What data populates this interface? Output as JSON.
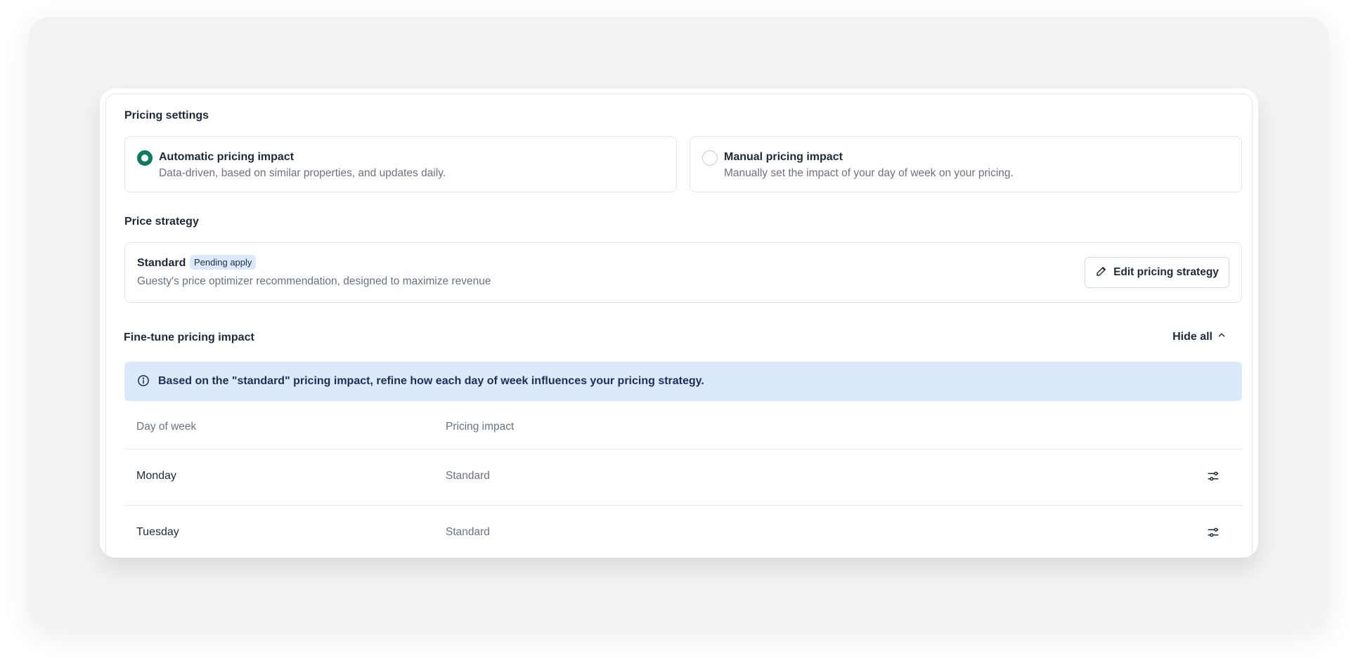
{
  "pricing_settings": {
    "title": "Pricing settings",
    "options": [
      {
        "title": "Automatic pricing impact",
        "description": "Data-driven, based on similar properties, and updates daily.",
        "selected": true
      },
      {
        "title": "Manual pricing impact",
        "description": "Manually set the impact of your day of week on your pricing.",
        "selected": false
      }
    ]
  },
  "price_strategy": {
    "title": "Price strategy",
    "name": "Standard",
    "badge": "Pending apply",
    "description": "Guesty's price optimizer recommendation, designed to maximize revenue",
    "edit_label": "Edit pricing strategy"
  },
  "fine_tune": {
    "title": "Fine-tune pricing impact",
    "hide_label": "Hide all",
    "info_text": "Based on the \"standard\" pricing impact, refine how each day of week influences your pricing strategy.",
    "columns": [
      "Day of week",
      "Pricing impact"
    ],
    "rows": [
      {
        "day": "Monday",
        "impact": "Standard"
      },
      {
        "day": "Tuesday",
        "impact": "Standard"
      }
    ]
  },
  "colors": {
    "accent": "#0f7a5f",
    "info_bg": "#dbe9fb"
  }
}
